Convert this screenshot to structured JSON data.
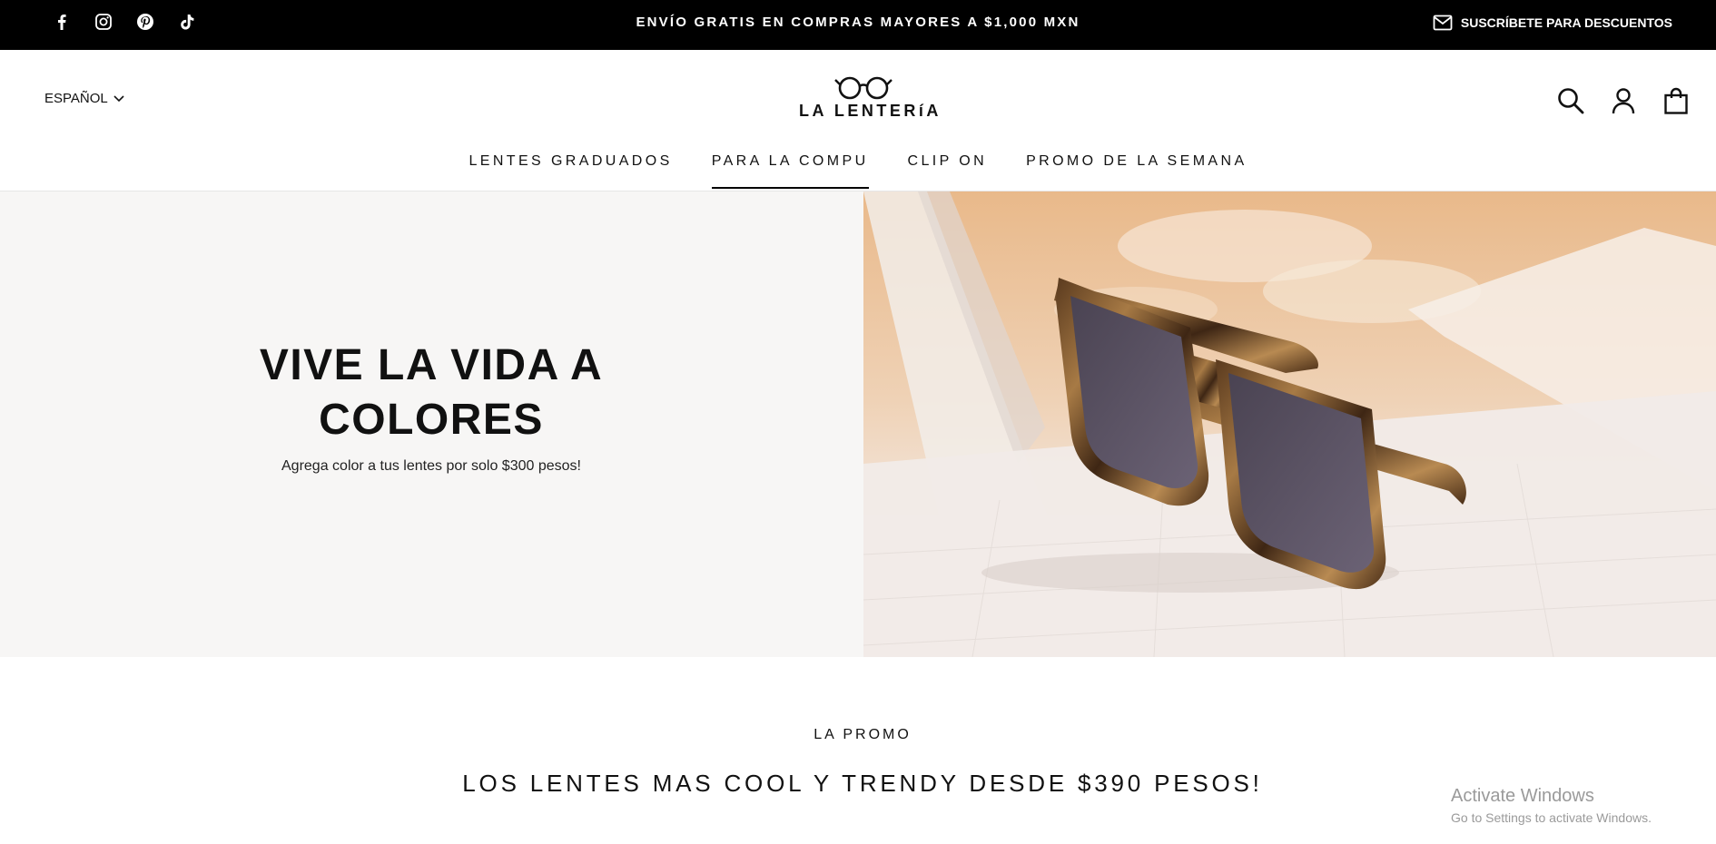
{
  "topbar": {
    "social_icons": [
      "facebook-icon",
      "instagram-icon",
      "pinterest-icon",
      "tiktok-icon"
    ],
    "announcement": "ENVÍO GRATIS EN COMPRAS MAYORES A $1,000 MXN",
    "subscribe_label": "SUSCRÍBETE PARA DESCUENTOS"
  },
  "header": {
    "language": "ESPAÑOL",
    "brand": "LA LENTERíA",
    "icons": [
      "search-icon",
      "account-icon",
      "bag-icon"
    ]
  },
  "nav": {
    "items": [
      {
        "label": "LENTES GRADUADOS",
        "active": false
      },
      {
        "label": "PARA LA COMPU",
        "active": true
      },
      {
        "label": "CLIP ON",
        "active": false
      },
      {
        "label": "PROMO DE LA SEMANA",
        "active": false
      }
    ]
  },
  "hero": {
    "title": "VIVE LA VIDA A COLORES",
    "subtitle": "Agrega color a tus lentes por solo $300 pesos!"
  },
  "promo": {
    "kicker": "LA PROMO",
    "title": "LOS LENTES MAS COOL Y TRENDY DESDE $390 PESOS!"
  },
  "watermark": {
    "line1": "Activate Windows",
    "line2": "Go to Settings to activate Windows."
  },
  "colors": {
    "topbar_bg": "#000000",
    "hero_left_bg": "#f7f6f5",
    "text": "#111111"
  }
}
